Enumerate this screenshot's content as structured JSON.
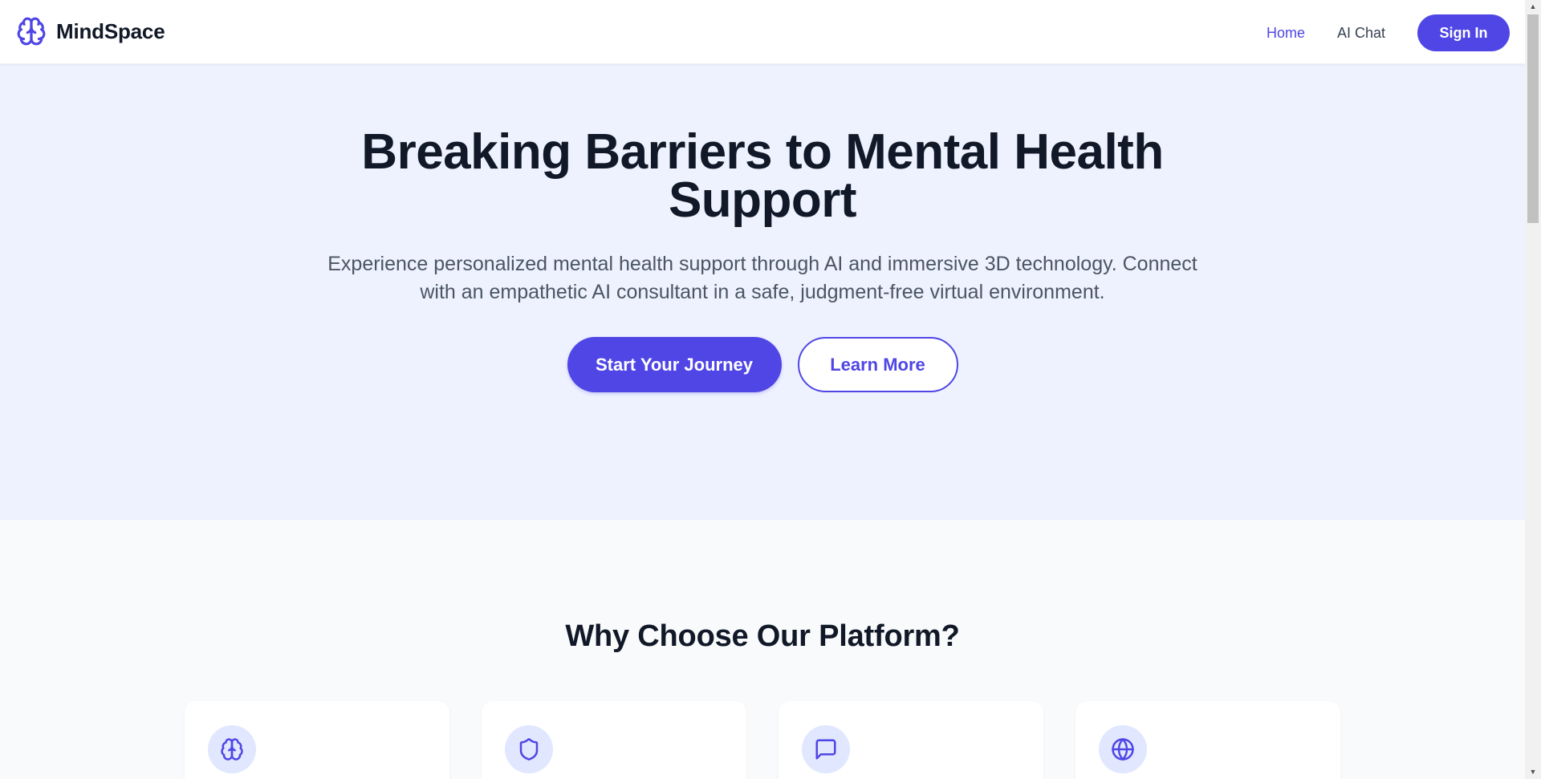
{
  "header": {
    "brand": "MindSpace",
    "nav": [
      {
        "label": "Home",
        "active": true
      },
      {
        "label": "AI Chat",
        "active": false
      }
    ],
    "signin_label": "Sign In"
  },
  "hero": {
    "title": "Breaking Barriers to Mental Health Support",
    "subtitle": "Experience personalized mental health support through AI and immersive 3D technology. Connect with an empathetic AI consultant in a safe, judgment-free virtual environment.",
    "primary_cta": "Start Your Journey",
    "secondary_cta": "Learn More"
  },
  "features": {
    "title": "Why Choose Our Platform?",
    "cards": [
      {
        "icon": "brain-icon"
      },
      {
        "icon": "shield-icon"
      },
      {
        "icon": "message-square-icon"
      },
      {
        "icon": "globe-icon"
      }
    ]
  },
  "colors": {
    "accent": "#4f46e5",
    "hero_bg": "#eef2ff",
    "features_bg": "#f9fafb",
    "icon_bg": "#e0e7ff",
    "text_dark": "#111827",
    "text_muted": "#4b5563"
  },
  "icons": {
    "brand": "brain-icon",
    "scroll_up": "triangle-up-icon",
    "scroll_down": "triangle-down-icon"
  }
}
